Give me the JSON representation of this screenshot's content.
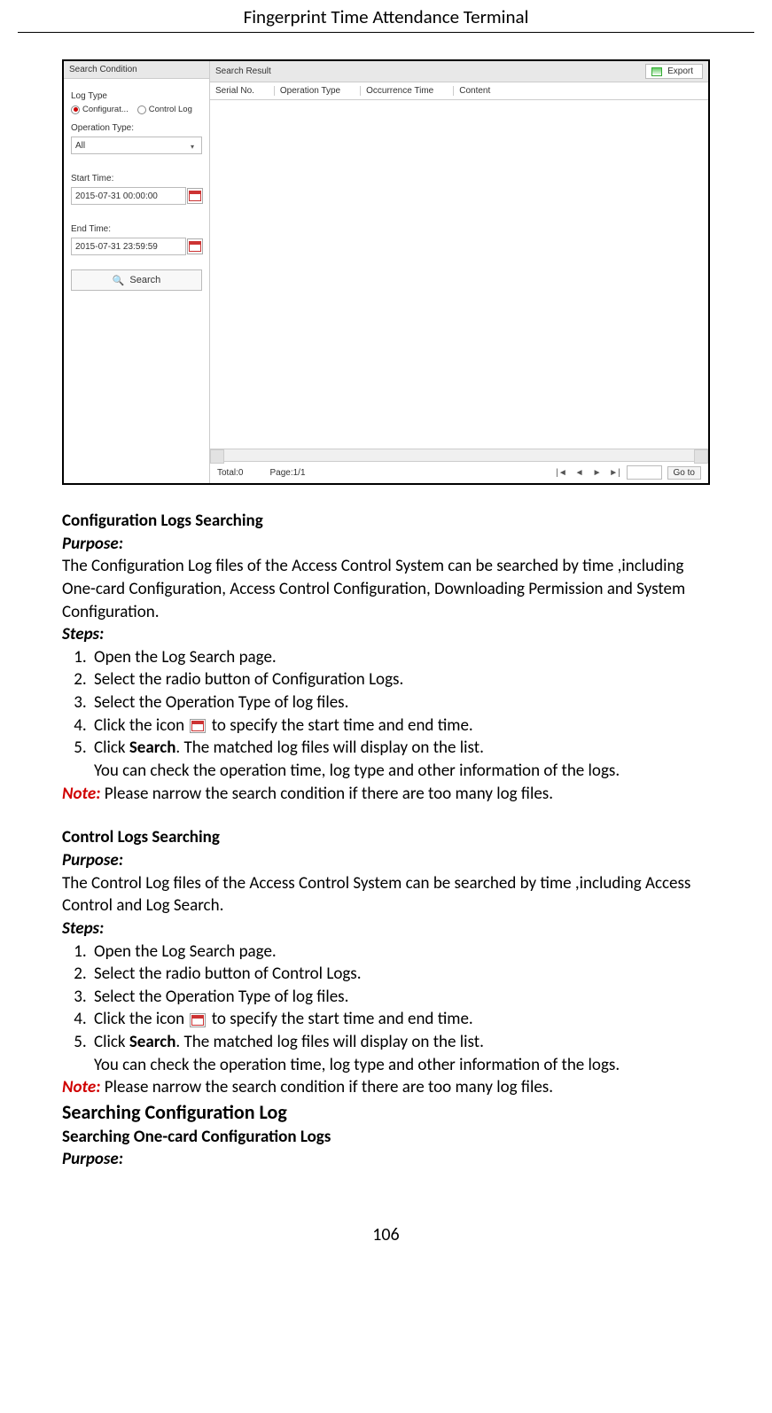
{
  "header": {
    "title": "Fingerprint Time Attendance Terminal"
  },
  "ui": {
    "sidebar_title": "Search Condition",
    "log_type_label": "Log Type",
    "radio_config": "Configurat...",
    "radio_control": "Control Log",
    "op_type_label": "Operation Type:",
    "op_type_value": "All",
    "start_label": "Start Time:",
    "start_value": "2015-07-31 00:00:00",
    "end_label": "End Time:",
    "end_value": "2015-07-31 23:59:59",
    "search_btn": "Search",
    "result_title": "Search Result",
    "export_btn": "Export",
    "cols": {
      "c1": "Serial No.",
      "c2": "Operation Type",
      "c3": "Occurrence Time",
      "c4": "Content"
    },
    "pager": {
      "total": "Total:0",
      "page": "Page:1/1",
      "goto": "Go to"
    }
  },
  "doc": {
    "h1": "Configuration Logs Searching",
    "purpose_label": "Purpose:",
    "p1a": "The Configuration Log files of the Access Control System can be searched by time ,including One-card Configuration, Access Control Configuration, Downloading Permission and System Configuration.",
    "steps_label": "Steps:",
    "s1_1": "Open the Log Search page.",
    "s1_2": "Select the radio button of Configuration Logs.",
    "s1_3": "Select the Operation Type of log files.",
    "s1_4a": "Click the icon",
    "s1_4b": "to specify the start time and end time.",
    "s1_5a": "Click ",
    "s1_5b": "Search",
    "s1_5c": ". The matched log files will display on the list.",
    "s1_5d": "You can check the operation time, log type and other information of the logs.",
    "note_label": "Note:",
    "note_text": " Please narrow the search condition if there are too many log files.",
    "h2": "Control Logs Searching",
    "p2a": "The Control Log files of the Access Control System can be searched by time ,including Access Control and Log Search.",
    "s2_1": "Open the Log Search page.",
    "s2_2": "Select the radio button of Control Logs.",
    "s2_3": "Select the Operation Type of log files.",
    "s2_4a": "Click the icon",
    "s2_4b": "to specify the start time and end time.",
    "s2_5a": "Click ",
    "s2_5b": "Search",
    "s2_5c": ". The matched log files will display on the list.",
    "s2_5d": "You can check the operation time, log type and other information of the logs.",
    "h3": "Searching Configuration Log",
    "h3sub": "Searching One-card Configuration Logs"
  },
  "page_num": "106"
}
